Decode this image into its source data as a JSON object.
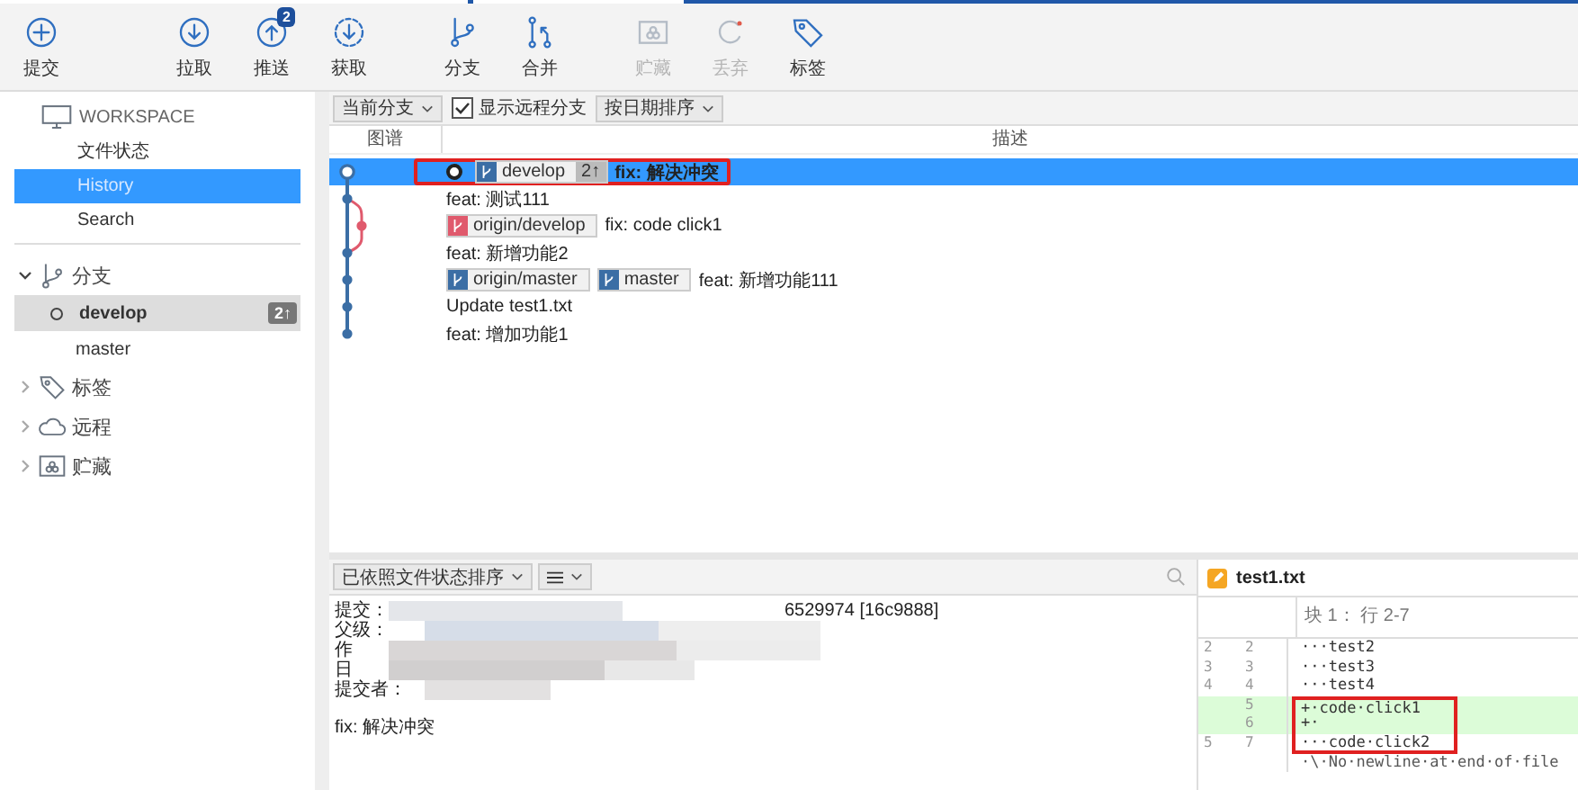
{
  "toolbar": [
    {
      "label": "提交",
      "disabled": false
    },
    {
      "label": "拉取",
      "disabled": false
    },
    {
      "label": "推送",
      "disabled": false,
      "badge": "2"
    },
    {
      "label": "获取",
      "disabled": false
    },
    {
      "label": "分支",
      "disabled": false
    },
    {
      "label": "合并",
      "disabled": false
    },
    {
      "label": "贮藏",
      "disabled": true
    },
    {
      "label": "丢弃",
      "disabled": true
    },
    {
      "label": "标签",
      "disabled": false
    }
  ],
  "sidebar": {
    "workspace": {
      "title": "WORKSPACE",
      "items": [
        {
          "label": "文件状态",
          "selected": false
        },
        {
          "label": "History",
          "selected": true
        },
        {
          "label": "Search",
          "selected": false
        }
      ]
    },
    "groups": [
      {
        "label": "分支",
        "expanded": true,
        "children": [
          {
            "label": "develop",
            "current": true,
            "selected": true,
            "badge": "2↑"
          },
          {
            "label": "master",
            "current": false,
            "selected": false
          }
        ]
      },
      {
        "label": "标签",
        "expanded": false
      },
      {
        "label": "远程",
        "expanded": false
      },
      {
        "label": "贮藏",
        "expanded": false
      }
    ]
  },
  "filter_bar": {
    "branch_dropdown": "当前分支",
    "show_remote": {
      "label": "显示远程分支",
      "checked": true
    },
    "sort_dropdown": "按日期排序"
  },
  "history": {
    "columns": [
      "图谱",
      "描述"
    ],
    "rows": [
      {
        "kind": "main",
        "head": true,
        "selected": true,
        "highlighted": true,
        "refs": [
          {
            "name": "develop",
            "color": "#3b6ea5",
            "ahead": "2↑"
          }
        ],
        "message": "fix: 解决冲突"
      },
      {
        "kind": "main",
        "head": false,
        "selected": false,
        "highlighted": false,
        "refs": [],
        "message": "feat: 测试111"
      },
      {
        "kind": "side",
        "head": false,
        "selected": false,
        "highlighted": false,
        "refs": [
          {
            "name": "origin/develop",
            "color": "#e05a6d"
          }
        ],
        "message": "fix: code click1"
      },
      {
        "kind": "main",
        "head": false,
        "selected": false,
        "highlighted": false,
        "refs": [],
        "message": "feat: 新增功能2"
      },
      {
        "kind": "main",
        "head": false,
        "selected": false,
        "highlighted": false,
        "refs": [
          {
            "name": "origin/master",
            "color": "#3b6ea5"
          },
          {
            "name": "master",
            "color": "#3b6ea5"
          }
        ],
        "message": "feat: 新增功能111"
      },
      {
        "kind": "main",
        "head": false,
        "selected": false,
        "highlighted": false,
        "refs": [],
        "message": "Update test1.txt"
      },
      {
        "kind": "main",
        "head": false,
        "selected": false,
        "highlighted": false,
        "refs": [],
        "message": "feat:  增加功能1"
      }
    ]
  },
  "details": {
    "sort_dropdown": "已依照文件状态排序",
    "fields": [
      {
        "label": "提交：",
        "value": "6529974 [16c9888]"
      },
      {
        "label": "父级："
      },
      {
        "label": "作"
      },
      {
        "label": "日"
      },
      {
        "label": "提交者："
      }
    ],
    "message": "fix: 解决冲突"
  },
  "diff": {
    "file": "test1.txt",
    "hunk": "块 1： 行 2-7",
    "lines": [
      {
        "old": "2",
        "new": "2",
        "kind": "context",
        "text": "···test2",
        "highlighted": false
      },
      {
        "old": "3",
        "new": "3",
        "kind": "context",
        "text": "···test3",
        "highlighted": false
      },
      {
        "old": "4",
        "new": "4",
        "kind": "context",
        "text": "···test4",
        "highlighted": false
      },
      {
        "new": "5",
        "kind": "add",
        "text": "+·code·click1",
        "highlighted": true
      },
      {
        "new": "6",
        "kind": "add",
        "text": "+·",
        "highlighted": true
      },
      {
        "old": "5",
        "new": "7",
        "kind": "context",
        "text": "···code·click2",
        "highlighted": true
      },
      {
        "kind": "meta",
        "text": "·\\·No·newline·at·end·of·file",
        "highlighted": false
      }
    ]
  }
}
